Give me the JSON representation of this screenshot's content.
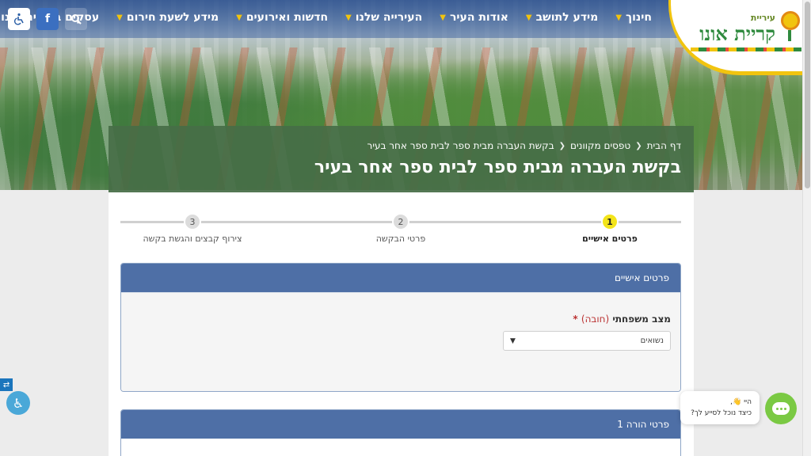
{
  "site": {
    "logo_small": "עיריית",
    "logo_big": "קריית אונו"
  },
  "nav": {
    "items": [
      {
        "label": "חינוך"
      },
      {
        "label": "מידע לתושב"
      },
      {
        "label": "אודות העיר"
      },
      {
        "label": "העירייה שלנו"
      },
      {
        "label": "חדשות ואירועים"
      },
      {
        "label": "מידע לשעת חירום"
      },
      {
        "label": "עסקים בקריית אונו"
      }
    ],
    "facebook_label": "f"
  },
  "breadcrumb": {
    "home": "דף הבית",
    "forms": "טפסים מקוונים",
    "current": "בקשת העברה מבית ספר לבית ספר אחר בעיר"
  },
  "page": {
    "title": "בקשת העברה מבית ספר לבית ספר אחר בעיר"
  },
  "stepper": {
    "steps": [
      {
        "number": "1",
        "label": "פרטים אישיים",
        "active": true
      },
      {
        "number": "2",
        "label": "פרטי הבקשה",
        "active": false
      },
      {
        "number": "3",
        "label": "צירוף קבצים והגשת בקשה",
        "active": false
      }
    ]
  },
  "personal_panel": {
    "title": "פרטים אישיים",
    "marital_label": "מצב משפחתי",
    "required_text": "(חובה)",
    "required_star": "*",
    "marital_value": "נשואים"
  },
  "parent_panel": {
    "title": "פרטי הורה 1"
  },
  "chat": {
    "greeting": "היי 👋,",
    "prompt": "כיצד נוכל לסייע לך?"
  },
  "colors": {
    "nav_bg": "#2d508c",
    "banner_bg": "#466e46",
    "panel_header": "#4e6fa6",
    "step_active": "#f3e41a",
    "chat_green": "#7ac943",
    "logo_green": "#2f8a3e",
    "logo_yellow": "#f1c40f"
  },
  "icons": {
    "accessibility": "wheelchair-icon",
    "facebook": "facebook-icon",
    "search": "search-icon",
    "chevron": "chevron-down-icon",
    "chat": "chat-icon"
  }
}
